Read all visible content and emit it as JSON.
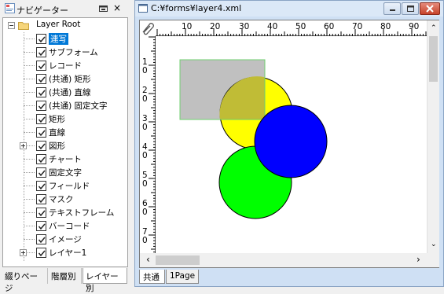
{
  "navigator": {
    "title": "ナビゲーター",
    "tree": [
      {
        "label": "Layer Root",
        "level": 0,
        "expanded": true,
        "checkbox": false,
        "folder": true
      },
      {
        "label": "連写",
        "level": 1,
        "checkbox": true,
        "selected": true
      },
      {
        "label": "サブフォーム",
        "level": 1,
        "checkbox": true
      },
      {
        "label": "レコード",
        "level": 1,
        "checkbox": true
      },
      {
        "label": "(共通) 矩形",
        "level": 1,
        "checkbox": true
      },
      {
        "label": "(共通) 直線",
        "level": 1,
        "checkbox": true
      },
      {
        "label": "(共通) 固定文字",
        "level": 1,
        "checkbox": true
      },
      {
        "label": "矩形",
        "level": 1,
        "checkbox": true
      },
      {
        "label": "直線",
        "level": 1,
        "checkbox": true
      },
      {
        "label": "図形",
        "level": 1,
        "checkbox": true,
        "collapsed": true
      },
      {
        "label": "チャート",
        "level": 1,
        "checkbox": true
      },
      {
        "label": "固定文字",
        "level": 1,
        "checkbox": true
      },
      {
        "label": "フィールド",
        "level": 1,
        "checkbox": true
      },
      {
        "label": "マスク",
        "level": 1,
        "checkbox": true
      },
      {
        "label": "テキストフレーム",
        "level": 1,
        "checkbox": true
      },
      {
        "label": "バーコード",
        "level": 1,
        "checkbox": true
      },
      {
        "label": "イメージ",
        "level": 1,
        "checkbox": true
      },
      {
        "label": "レイヤー1",
        "level": 1,
        "checkbox": true,
        "collapsed": true
      }
    ],
    "tabs": [
      "綴りページ",
      "階層別",
      "レイヤー別"
    ],
    "active_tab": 2,
    "pin_icon": "pin-icon",
    "close_icon": "close-icon"
  },
  "document": {
    "title": "C:¥forms¥layer4.xml",
    "ruler_top": [
      "10",
      "20",
      "30",
      "40",
      "50",
      "60",
      "70",
      "80",
      "90"
    ],
    "ruler_left": [
      "1",
      "0",
      "2",
      "0",
      "3",
      "0",
      "4",
      "0",
      "5",
      "0",
      "6",
      "0",
      "7",
      "0"
    ],
    "tabs": [
      "共通",
      "1Page"
    ],
    "active_tab": 0,
    "shapes": {
      "rect_fill": "#c0c0c0",
      "rect_stroke": "#6fcf6f",
      "yellow": "#ffff00",
      "blue": "#0000ff",
      "green": "#00ff00",
      "overlap": "#c0bc36"
    }
  }
}
